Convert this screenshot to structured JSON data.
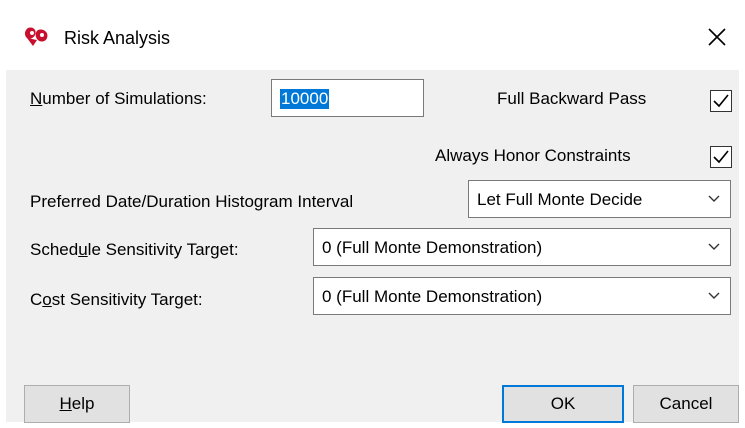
{
  "window": {
    "title": "Risk Analysis",
    "icon": "full-monte-logo-icon",
    "close_glyph": "✕"
  },
  "form": {
    "num_sims": {
      "label_pre": "",
      "label_key": "N",
      "label_post": "umber of Simulations:",
      "value": "10000"
    },
    "full_backward_pass": {
      "label": "Full Backward Pass",
      "checked": true
    },
    "always_honor_constraints": {
      "label": "Always Honor Constraints",
      "checked": true
    },
    "histogram_interval": {
      "label": "Preferred Date/Duration Histogram Interval",
      "value": "Let Full Monte Decide"
    },
    "schedule_target": {
      "label_pre": "Sched",
      "label_key": "u",
      "label_post": "le Sensitivity Target:",
      "value": "0 (Full Monte Demonstration)"
    },
    "cost_target": {
      "label_pre": "C",
      "label_key": "o",
      "label_post": "st Sensitivity Target:",
      "value": "0 (Full Monte Demonstration)"
    }
  },
  "buttons": {
    "help": {
      "pre": "",
      "key": "H",
      "post": "elp"
    },
    "ok": "OK",
    "cancel": "Cancel"
  },
  "colors": {
    "accent": "#0078d7",
    "dialog_bg": "#f0f0f0",
    "logo_red": "#c8102e"
  }
}
